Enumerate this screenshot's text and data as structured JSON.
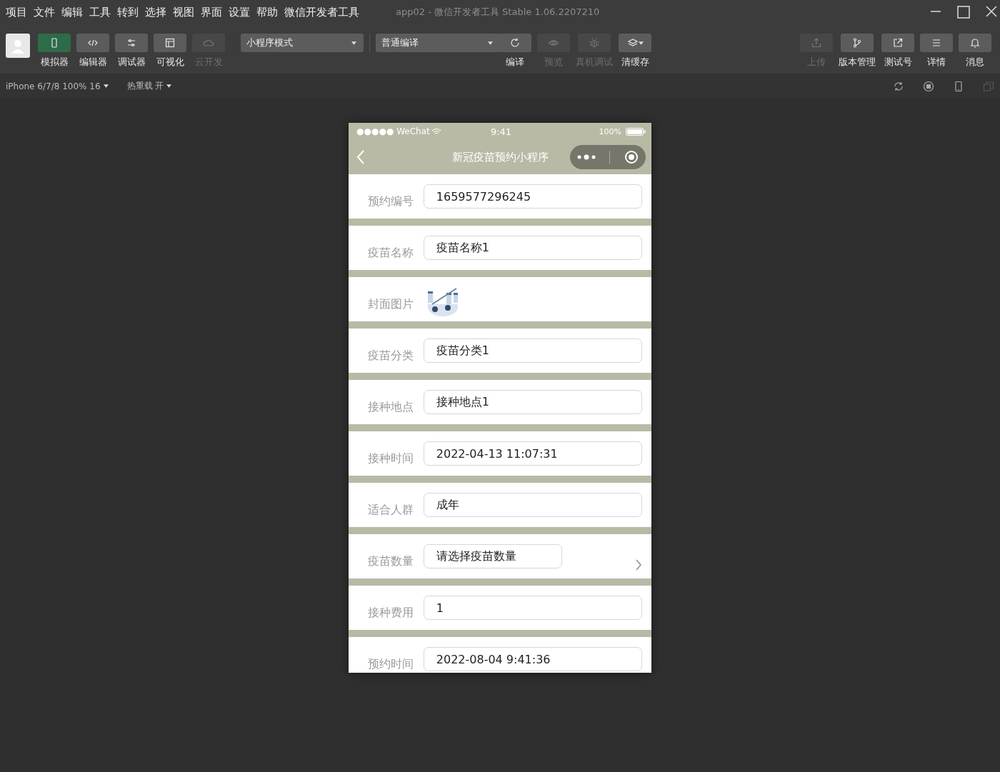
{
  "menu_bar": {
    "items": [
      "项目",
      "文件",
      "编辑",
      "工具",
      "转到",
      "选择",
      "视图",
      "界面",
      "设置",
      "帮助",
      "微信开发者工具"
    ],
    "title": "app02 - 微信开发者工具 Stable 1.06.2207210"
  },
  "toolbar": {
    "view_buttons": [
      {
        "label": "模拟器",
        "selected": true,
        "disabled": false
      },
      {
        "label": "编辑器",
        "selected": false,
        "disabled": false
      },
      {
        "label": "调试器",
        "selected": false,
        "disabled": false
      },
      {
        "label": "可视化",
        "selected": false,
        "disabled": false
      },
      {
        "label": "云开发",
        "selected": false,
        "disabled": true
      }
    ],
    "mode_dropdown": "小程序模式",
    "compile_dropdown": "普通编译",
    "actions": [
      {
        "label": "编译",
        "disabled": false
      },
      {
        "label": "预览",
        "disabled": true
      },
      {
        "label": "真机调试",
        "disabled": true
      },
      {
        "label": "清缓存",
        "disabled": false
      }
    ],
    "right_actions": [
      {
        "label": "上传",
        "disabled": true
      },
      {
        "label": "版本管理",
        "disabled": false
      },
      {
        "label": "测试号",
        "disabled": false
      },
      {
        "label": "详情",
        "disabled": false
      },
      {
        "label": "消息",
        "disabled": false
      }
    ]
  },
  "sub_toolbar": {
    "device": "iPhone 6/7/8 100% 16",
    "hot_reload": "热重载 开"
  },
  "phone": {
    "status_bar": {
      "carrier": "●●●●● WeChat",
      "time": "9:41",
      "battery": "100%"
    },
    "nav_title": "新冠疫苗预约小程序",
    "rows": [
      {
        "kind": "text",
        "label": "预约编号",
        "value": "1659577296245"
      },
      {
        "kind": "text",
        "label": "疫苗名称",
        "value": "疫苗名称1"
      },
      {
        "kind": "image",
        "label": "封面图片"
      },
      {
        "kind": "text",
        "label": "疫苗分类",
        "value": "疫苗分类1"
      },
      {
        "kind": "text",
        "label": "接种地点",
        "value": "接种地点1"
      },
      {
        "kind": "text",
        "label": "接种时间",
        "value": "2022-04-13 11:07:31"
      },
      {
        "kind": "text",
        "label": "适合人群",
        "value": "成年"
      },
      {
        "kind": "picker",
        "label": "疫苗数量",
        "value": "请选择疫苗数量"
      },
      {
        "kind": "text",
        "label": "接种费用",
        "value": "1"
      },
      {
        "kind": "text",
        "label": "预约时间",
        "value": "2022-08-04 9:41:36"
      }
    ]
  }
}
